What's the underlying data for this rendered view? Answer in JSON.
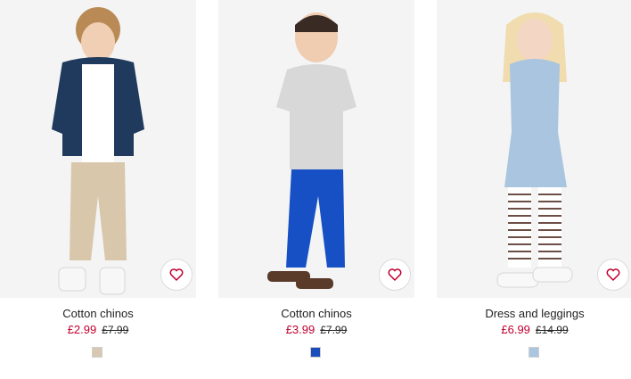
{
  "products": [
    {
      "name": "Cotton chinos",
      "price": "£2.99",
      "old_price": "£7.99",
      "swatch_color": "#d8c7b1"
    },
    {
      "name": "Cotton chinos",
      "price": "£3.99",
      "old_price": "£7.99",
      "swatch_color": "#1a4dbb"
    },
    {
      "name": "Dress and leggings",
      "price": "£6.99",
      "old_price": "£14.99",
      "swatch_color": "#a9c5df"
    }
  ],
  "accent_color": "#c0002d",
  "icons": {
    "favorite": "heart-outline-icon"
  }
}
